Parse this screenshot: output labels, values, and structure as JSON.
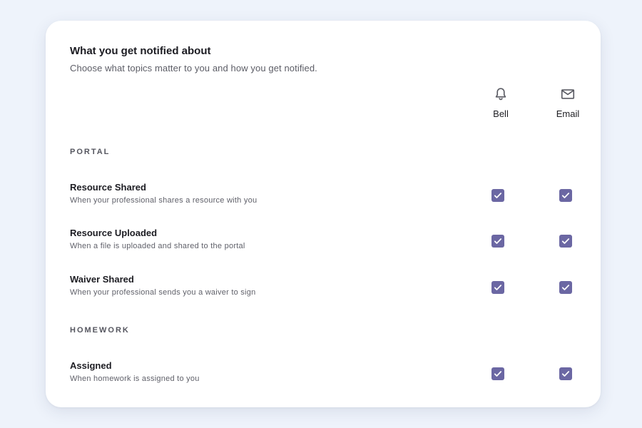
{
  "header": {
    "title": "What you get notified about",
    "subtitle": "Choose what topics matter to you and how you get notified."
  },
  "columns": [
    {
      "label": "Bell",
      "icon": "bell-icon"
    },
    {
      "label": "Email",
      "icon": "mail-icon"
    }
  ],
  "sections": [
    {
      "label": "PORTAL",
      "rows": [
        {
          "title": "Resource Shared",
          "description": "When your professional shares a resource with you",
          "bell": true,
          "email": true
        },
        {
          "title": "Resource Uploaded",
          "description": "When a file is uploaded and shared to the portal",
          "bell": true,
          "email": true
        },
        {
          "title": "Waiver Shared",
          "description": "When your professional sends you a waiver to sign",
          "bell": true,
          "email": true
        }
      ]
    },
    {
      "label": "HOMEWORK",
      "rows": [
        {
          "title": "Assigned",
          "description": "When homework is assigned to you",
          "bell": true,
          "email": true
        }
      ]
    }
  ],
  "colors": {
    "accent": "#6b67a3",
    "background": "#eef3fb",
    "card": "#ffffff"
  }
}
